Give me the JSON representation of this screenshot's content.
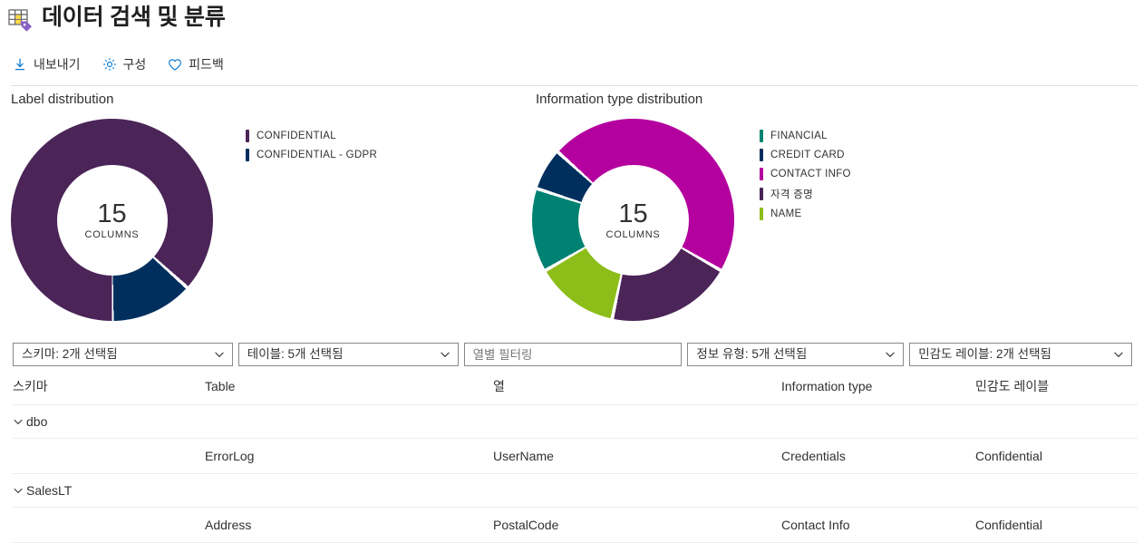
{
  "header": {
    "icon": "data-classification-icon",
    "title": "데이터 검색 및 분류"
  },
  "command_bar": {
    "items": [
      {
        "icon": "download-icon",
        "label": "내보내기"
      },
      {
        "icon": "gear-icon",
        "label": "구성"
      },
      {
        "icon": "heart-icon",
        "label": "피드백"
      }
    ]
  },
  "chart_data": [
    {
      "type": "pie",
      "title": "Label distribution",
      "center_value": "15",
      "center_unit": "COLUMNS",
      "total": 15,
      "categories": [
        "CONFIDENTIAL",
        "CONFIDENTIAL - GDPR"
      ],
      "values": [
        13,
        2
      ],
      "colors": [
        "#4b2458",
        "#002f5e"
      ],
      "legend_position": "right"
    },
    {
      "type": "pie",
      "title": "Information type distribution",
      "center_value": "15",
      "center_unit": "COLUMNS",
      "total": 15,
      "categories": [
        "FINANCIAL",
        "CREDIT CARD",
        "CONTACT INFO",
        "자격 증명",
        "NAME"
      ],
      "values": [
        2,
        1,
        7,
        3,
        2
      ],
      "colors": [
        "#008272",
        "#002f5e",
        "#b4009e",
        "#4b2458",
        "#8cbd18"
      ],
      "legend_position": "right"
    }
  ],
  "filters": [
    {
      "name": "schema-filter",
      "value": "스키마: 2개 선택됨",
      "type": "dropdown"
    },
    {
      "name": "table-filter",
      "value": "테이블: 5개 선택됨",
      "type": "dropdown"
    },
    {
      "name": "column-filter",
      "value": "",
      "placeholder": "열별 필터링",
      "type": "textbox"
    },
    {
      "name": "information-type-filter",
      "value": "정보 유형: 5개 선택됨",
      "type": "dropdown"
    },
    {
      "name": "sensitivity-label-filter",
      "value": "민감도 레이블: 2개 선택됨",
      "type": "dropdown"
    }
  ],
  "table": {
    "columns": [
      "스키마",
      "Table",
      "열",
      "Information type",
      "민감도 레이블"
    ],
    "rows": [
      {
        "kind": "group",
        "schema": "dbo",
        "table": "",
        "column": "",
        "information_type": "",
        "label": ""
      },
      {
        "kind": "data",
        "schema": "",
        "table": "ErrorLog",
        "column": "UserName",
        "information_type": "Credentials",
        "label": "Confidential"
      },
      {
        "kind": "group",
        "schema": "SalesLT",
        "table": "",
        "column": "",
        "information_type": "",
        "label": ""
      },
      {
        "kind": "data",
        "schema": "",
        "table": "Address",
        "column": "PostalCode",
        "information_type": "Contact Info",
        "label": "Confidential"
      }
    ]
  },
  "theme": {
    "accent": "#0078d4",
    "text": "#323130",
    "border": "#edebe9"
  }
}
